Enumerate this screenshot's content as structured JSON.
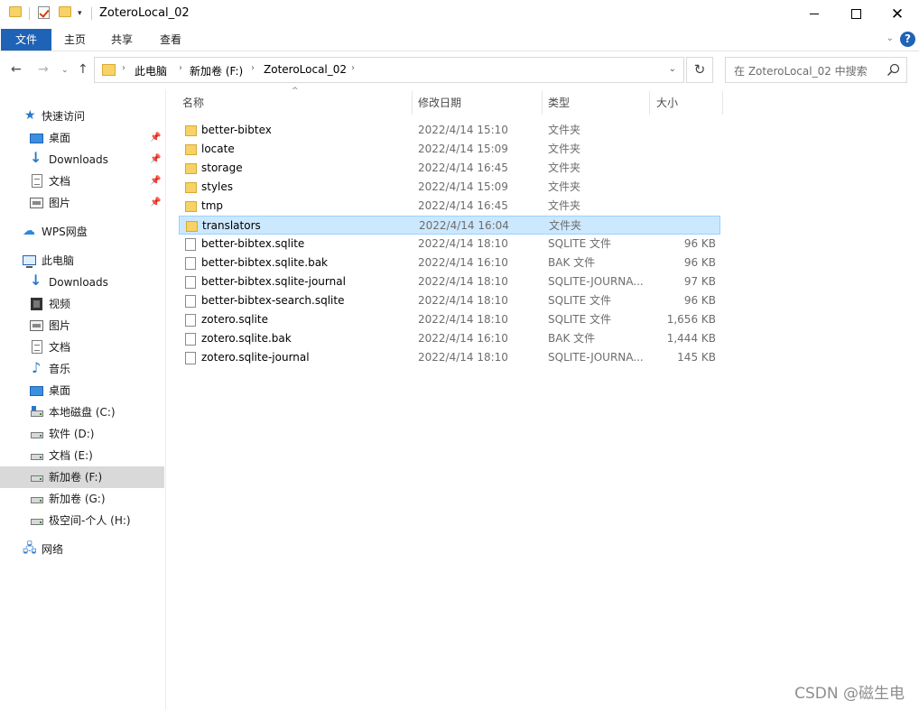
{
  "window": {
    "title": "ZoteroLocal_02"
  },
  "ribbon": {
    "tabs": [
      "文件",
      "主页",
      "共享",
      "查看"
    ]
  },
  "address": {
    "crumbs": [
      "此电脑",
      "新加卷 (F:)",
      "ZoteroLocal_02"
    ],
    "search_placeholder": "在 ZoteroLocal_02 中搜索"
  },
  "nav": {
    "quick_access": "快速访问",
    "items": [
      {
        "label": "桌面"
      },
      {
        "label": "Downloads"
      },
      {
        "label": "文档"
      },
      {
        "label": "图片"
      },
      {
        "label": "WPS网盘"
      },
      {
        "label": "此电脑"
      },
      {
        "label": "Downloads"
      },
      {
        "label": "视频"
      },
      {
        "label": "图片"
      },
      {
        "label": "文档"
      },
      {
        "label": "音乐"
      },
      {
        "label": "桌面"
      },
      {
        "label": "本地磁盘 (C:)"
      },
      {
        "label": "软件 (D:)"
      },
      {
        "label": "文档 (E:)"
      },
      {
        "label": "新加卷 (F:)"
      },
      {
        "label": "新加卷 (G:)"
      },
      {
        "label": "极空间-个人 (H:)"
      },
      {
        "label": "网络"
      }
    ]
  },
  "columns": {
    "name": "名称",
    "date": "修改日期",
    "type": "类型",
    "size": "大小"
  },
  "files": [
    {
      "name": "better-bibtex",
      "date": "2022/4/14 15:10",
      "type": "文件夹",
      "size": ""
    },
    {
      "name": "locate",
      "date": "2022/4/14 15:09",
      "type": "文件夹",
      "size": ""
    },
    {
      "name": "storage",
      "date": "2022/4/14 16:45",
      "type": "文件夹",
      "size": ""
    },
    {
      "name": "styles",
      "date": "2022/4/14 15:09",
      "type": "文件夹",
      "size": ""
    },
    {
      "name": "tmp",
      "date": "2022/4/14 16:45",
      "type": "文件夹",
      "size": ""
    },
    {
      "name": "translators",
      "date": "2022/4/14 16:04",
      "type": "文件夹",
      "size": ""
    },
    {
      "name": "better-bibtex.sqlite",
      "date": "2022/4/14 18:10",
      "type": "SQLITE 文件",
      "size": "96 KB"
    },
    {
      "name": "better-bibtex.sqlite.bak",
      "date": "2022/4/14 16:10",
      "type": "BAK 文件",
      "size": "96 KB"
    },
    {
      "name": "better-bibtex.sqlite-journal",
      "date": "2022/4/14 18:10",
      "type": "SQLITE-JOURNA...",
      "size": "97 KB"
    },
    {
      "name": "better-bibtex-search.sqlite",
      "date": "2022/4/14 18:10",
      "type": "SQLITE 文件",
      "size": "96 KB"
    },
    {
      "name": "zotero.sqlite",
      "date": "2022/4/14 18:10",
      "type": "SQLITE 文件",
      "size": "1,656 KB"
    },
    {
      "name": "zotero.sqlite.bak",
      "date": "2022/4/14 16:10",
      "type": "BAK 文件",
      "size": "1,444 KB"
    },
    {
      "name": "zotero.sqlite-journal",
      "date": "2022/4/14 18:10",
      "type": "SQLITE-JOURNA...",
      "size": "145 KB"
    }
  ],
  "watermark": "CSDN @磁生电"
}
